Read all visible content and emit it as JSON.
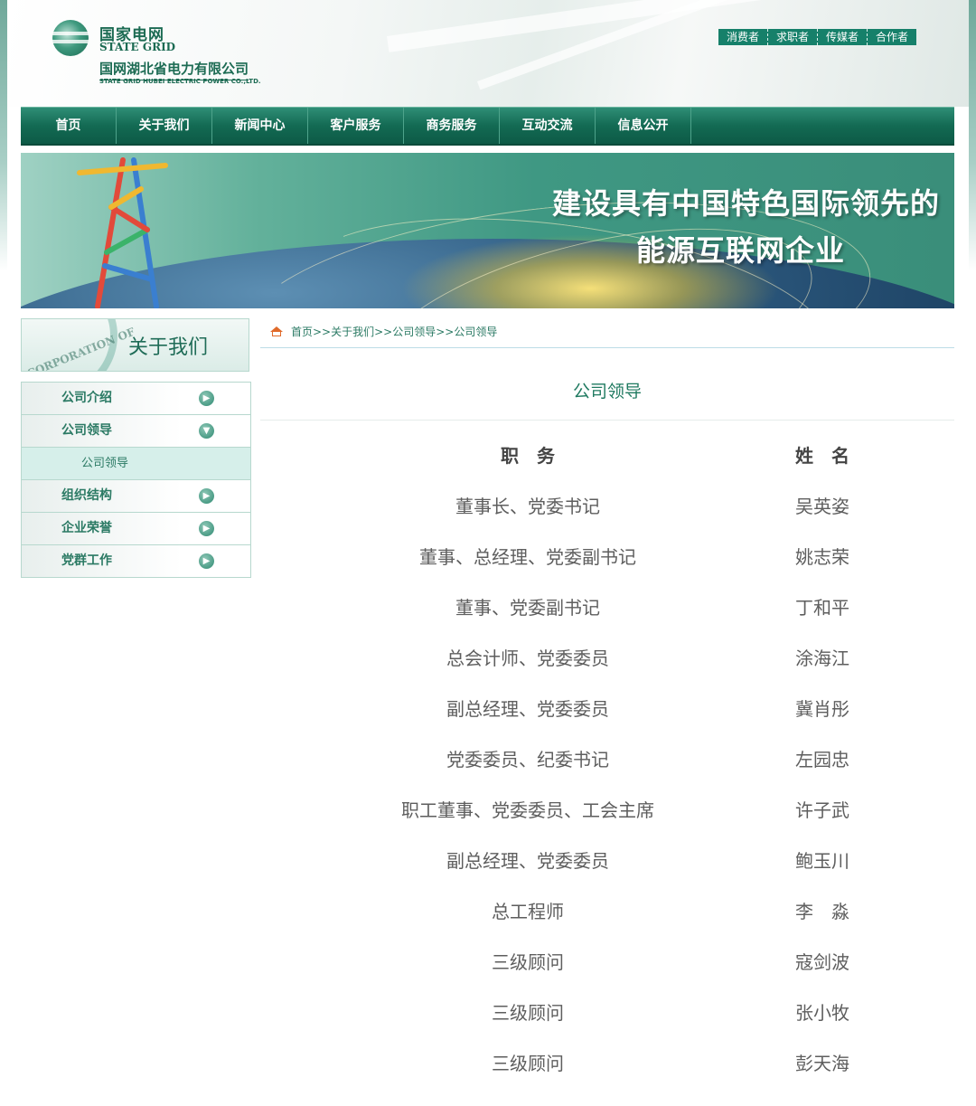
{
  "header": {
    "logo_cn": "国家电网",
    "logo_en": "STATE GRID",
    "company_cn": "国网湖北省电力有限公司",
    "company_en": "STATE GRID HUBEI ELECTRIC POWER CO.,LTD.",
    "top_links": [
      "消费者",
      "求职者",
      "传媒者",
      "合作者"
    ]
  },
  "nav": [
    "首页",
    "关于我们",
    "新闻中心",
    "客户服务",
    "商务服务",
    "互动交流",
    "信息公开"
  ],
  "banner": {
    "line1": "建设具有中国特色国际领先的",
    "line2": "能源互联网企业"
  },
  "sidebar": {
    "title": "关于我们",
    "seal_text": "CORPORATION OF",
    "items": [
      {
        "label": "公司介绍",
        "icon": "arrow-right-icon"
      },
      {
        "label": "公司领导",
        "icon": "arrow-down-icon"
      },
      {
        "label": "公司领导",
        "sub": true
      },
      {
        "label": "组织结构",
        "icon": "arrow-right-icon"
      },
      {
        "label": "企业荣誉",
        "icon": "arrow-right-icon"
      },
      {
        "label": "党群工作",
        "icon": "arrow-right-icon"
      }
    ]
  },
  "breadcrumb": "首页>>关于我们>>公司领导>>公司领导",
  "page_title": "公司领导",
  "table": {
    "headers": [
      "职　务",
      "姓　名"
    ],
    "rows": [
      [
        "董事长、党委书记",
        "吴英姿"
      ],
      [
        "董事、总经理、党委副书记",
        "姚志荣"
      ],
      [
        "董事、党委副书记",
        "丁和平"
      ],
      [
        "总会计师、党委委员",
        "涂海江"
      ],
      [
        "副总经理、党委委员",
        "冀肖彤"
      ],
      [
        "党委委员、纪委书记",
        "左园忠"
      ],
      [
        "职工董事、党委委员、工会主席",
        "许子武"
      ],
      [
        "副总经理、党委委员",
        "鲍玉川"
      ],
      [
        "总工程师",
        "李　淼"
      ],
      [
        "三级顾问",
        "寇剑波"
      ],
      [
        "三级顾问",
        "张小牧"
      ],
      [
        "三级顾问",
        "彭天海"
      ]
    ]
  },
  "colors": {
    "brand_green": "#16806a",
    "nav_green": "#136a53",
    "title_green": "#1f7a60",
    "breadcrumb_home": "#e06a2a"
  }
}
